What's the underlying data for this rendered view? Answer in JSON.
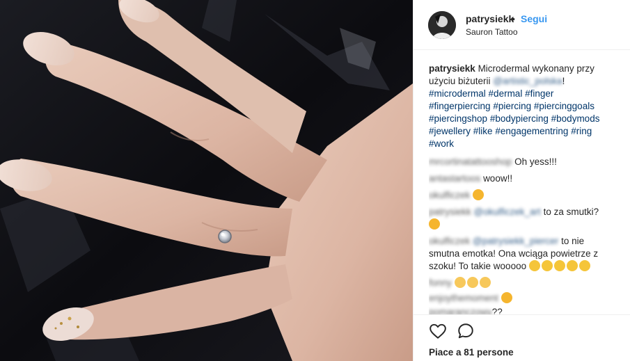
{
  "post": {
    "username": "patrysiekk",
    "separator": "•",
    "follow_label": "Segui",
    "location": "Sauron Tattoo"
  },
  "caption": {
    "username": "patrysiekk",
    "text_1": "Microdermal wykonany przy użyciu biżuterii",
    "mention": "@artistic_polska",
    "text_2": "!",
    "hashtags": [
      "#microdermal",
      "#dermal",
      "#finger",
      "#fingerpiercing",
      "#piercing",
      "#piercinggoals",
      "#piercingshop",
      "#bodypiercing",
      "#bodymods",
      "#jewellery",
      "#like",
      "#engagementring",
      "#ring",
      "#work"
    ]
  },
  "comments": [
    {
      "username": "mrcortinatattooshop",
      "text": "Oh yess!!!"
    },
    {
      "username": "antastartoos",
      "text": "woow!!"
    },
    {
      "username": "okulficzek",
      "text": "",
      "emoji": [
        "sad"
      ]
    },
    {
      "username": "patrysiekk",
      "mention": "@okulficzek_art",
      "text": "to za smutki?",
      "emoji": [
        "think"
      ]
    },
    {
      "username": "okulficzek",
      "mention": "@patrysiekk_piercer",
      "text": "to nie smutna emotka! Ona wciąga powietrze z szoku! To takie wooooo",
      "emoji": [
        "scream",
        "scream",
        "scream",
        "scream",
        "scream"
      ]
    },
    {
      "username": "fonny",
      "text": "",
      "emoji": [
        "grim",
        "grim",
        "grim"
      ]
    },
    {
      "username": "enjoythemoment",
      "text": "",
      "emoji": [
        "love"
      ]
    },
    {
      "username": "pomaranczowy",
      "text": "??"
    }
  ],
  "actions": {
    "like_icon": "heart-icon",
    "comment_icon": "comment-icon",
    "likes_text": "Piace a 81 persone"
  },
  "colors": {
    "link": "#3897f0",
    "hashtag": "#003569",
    "text": "#262626",
    "border": "#efefef"
  }
}
